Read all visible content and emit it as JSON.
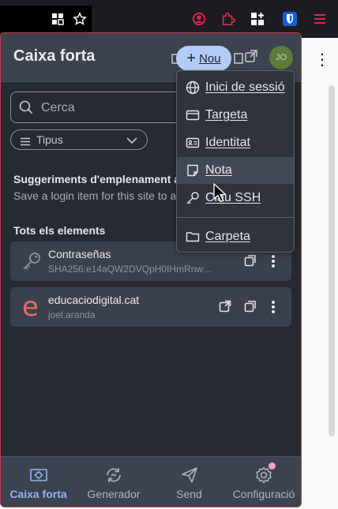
{
  "browser": {
    "icons": [
      "grid-icon",
      "star-icon",
      "account-icon",
      "extension-icon",
      "extensions-grid-icon",
      "bitwarden-shield-icon",
      "menu-icon"
    ],
    "accent_red": "#e22850"
  },
  "vault": {
    "title": "Caixa forta",
    "new_button_label": "Nou",
    "avatar_initials": "JO",
    "search_placeholder": "Cerca",
    "type_filter_label": "Tipus",
    "suggestions_title": "Suggeriments d'emplenament au",
    "suggestions_desc": "Save a login item for this site to a",
    "all_items_title": "Tots els elements",
    "items": [
      {
        "name": "Contraseñas",
        "subtitle": "SHA256:e14aQW2DVQpH0IHmRnw…",
        "icon": "key-icon"
      },
      {
        "name": "educaciodigital.cat",
        "subtitle": "joel.aranda",
        "icon": "site-favicon-e"
      }
    ]
  },
  "new_menu": {
    "items": [
      {
        "label": "Inici de sessió",
        "icon": "globe-icon"
      },
      {
        "label": "Targeta",
        "icon": "card-icon"
      },
      {
        "label": "Identitat",
        "icon": "id-card-icon"
      },
      {
        "label": "Nota",
        "icon": "note-icon"
      },
      {
        "label": "Clau SSH",
        "icon": "ssh-key-icon"
      },
      {
        "label": "Carpeta",
        "icon": "folder-icon"
      }
    ],
    "hovered": "Nota"
  },
  "footer": {
    "tabs": [
      {
        "label": "Caixa forta",
        "icon": "vault-icon",
        "active": true
      },
      {
        "label": "Generador",
        "icon": "generator-icon",
        "active": false
      },
      {
        "label": "Send",
        "icon": "send-icon",
        "active": false
      },
      {
        "label": "Configuració",
        "icon": "settings-icon",
        "active": false
      }
    ]
  },
  "colors": {
    "accent_blue": "#8fb4f5",
    "button_blue": "#b4cbf7",
    "panel_bg": "#262a33",
    "border_red": "#c83e4d"
  }
}
